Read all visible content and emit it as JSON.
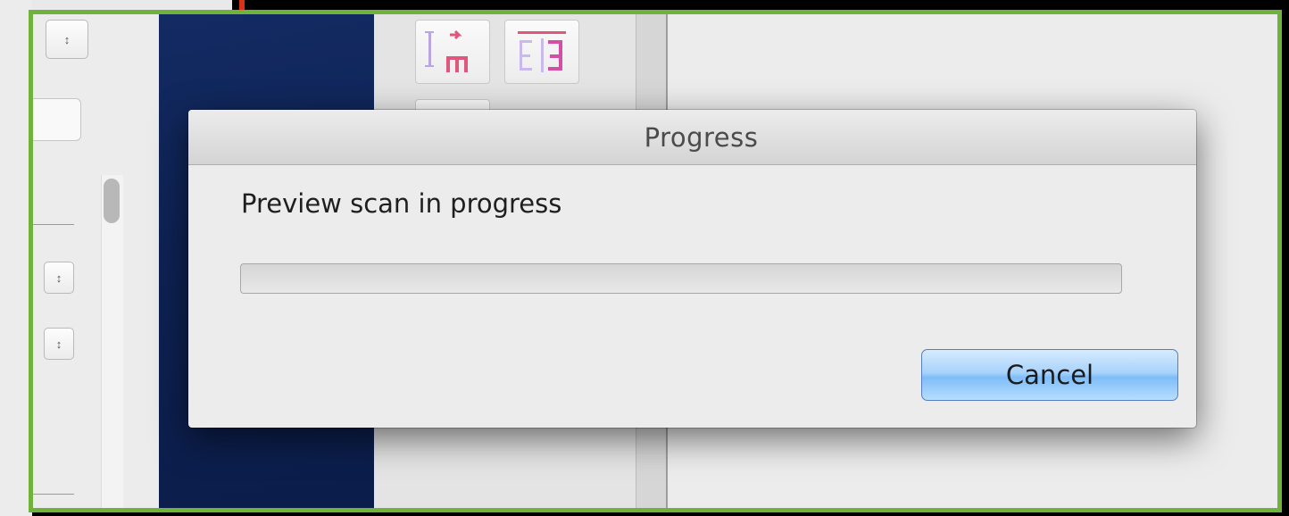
{
  "dialog": {
    "title": "Progress",
    "message": "Preview scan in progress",
    "progress_fraction": 0,
    "cancel_label": "Cancel"
  },
  "colors": {
    "frame_outline": "#6fb33a",
    "button_accent": "#7fbdf8",
    "preview_background": "#0e2254"
  },
  "icons": {
    "tool_1": "rotate-crop-icon",
    "tool_2": "mirror-split-icon",
    "stepper": "stepper-arrows-icon"
  }
}
